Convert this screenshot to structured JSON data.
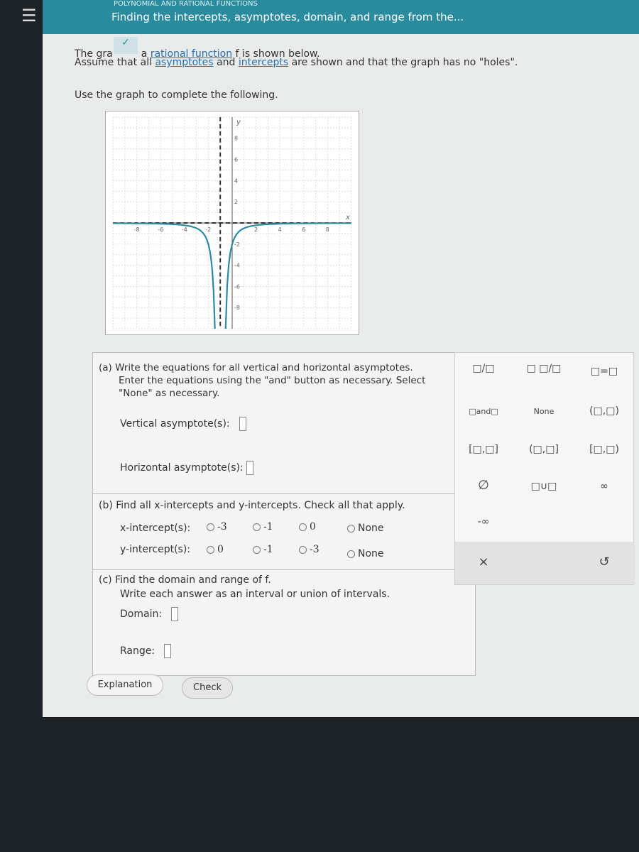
{
  "header": {
    "menu_icon": "hamburger-icon",
    "section": "POLYNOMIAL AND RATIONAL FUNCTIONS",
    "title": "Finding the intercepts, asymptotes, domain, and range from the..."
  },
  "intro": {
    "line1_a": "The gra",
    "line1_link": "rational function",
    "line1_b": "f is shown below.",
    "line1_pre": "a",
    "line2_a": "Assume that all",
    "line2_link1": "asymptotes",
    "line2_and": "and",
    "line2_link2": "intercepts",
    "line2_b": "are shown and that the graph has no \"holes\".",
    "line3": "Use the graph to complete the following."
  },
  "chart_data": {
    "type": "line",
    "xlabel": "x",
    "ylabel": "y",
    "xlim": [
      -10,
      10
    ],
    "ylim": [
      -10,
      10
    ],
    "xticks": [
      "-8",
      "-6",
      "-4",
      "-2",
      "2",
      "4",
      "6",
      "8"
    ],
    "yticks": [
      "8",
      "6",
      "4",
      "2",
      "-2",
      "-4",
      "-6",
      "-8"
    ],
    "grid": true,
    "vertical_asymptote": -1,
    "horizontal_asymptote": 0,
    "curve_color": "#2a8a9e",
    "points": [
      [
        -10,
        -0.02
      ],
      [
        -6,
        -0.08
      ],
      [
        -4,
        -0.22
      ],
      [
        -3,
        -0.5
      ],
      [
        -2,
        -2
      ],
      [
        -1.5,
        -8
      ],
      [
        -0.5,
        -8
      ],
      [
        0,
        -2
      ],
      [
        1,
        -0.5
      ],
      [
        2,
        -0.22
      ],
      [
        4,
        -0.08
      ],
      [
        10,
        -0.02
      ]
    ]
  },
  "part_a": {
    "prompt": "(a) Write the equations for all vertical and horizontal asymptotes. Enter the equations using the \"and\" button as necessary. Select \"None\" as necessary.",
    "vertical_label": "Vertical asymptote(s):",
    "horizontal_label": "Horizontal asymptote(s):"
  },
  "part_b": {
    "prompt": "(b) Find all x-intercepts and y-intercepts. Check all that apply.",
    "x_label": "x-intercept(s):",
    "x_options": [
      "-3",
      "-1",
      "0",
      "None"
    ],
    "y_label": "y-intercept(s):",
    "y_options": [
      "0",
      "-1",
      "-3",
      "None"
    ]
  },
  "part_c": {
    "prompt": "(c) Find the domain and range of f.",
    "prompt2": "Write each answer as an interval or union of intervals.",
    "domain_label": "Domain:",
    "range_label": "Range:"
  },
  "keypad": {
    "keys": [
      "□/□",
      "□ □/□",
      "□=□",
      "□and□",
      "None",
      "(□,□)",
      "[□,□]",
      "(□,□]",
      "[□,□)",
      "∅",
      "□∪□",
      "∞",
      "-∞"
    ],
    "clear": "×",
    "undo": "↺"
  },
  "buttons": {
    "explanation": "Explanation",
    "check": "Check"
  }
}
